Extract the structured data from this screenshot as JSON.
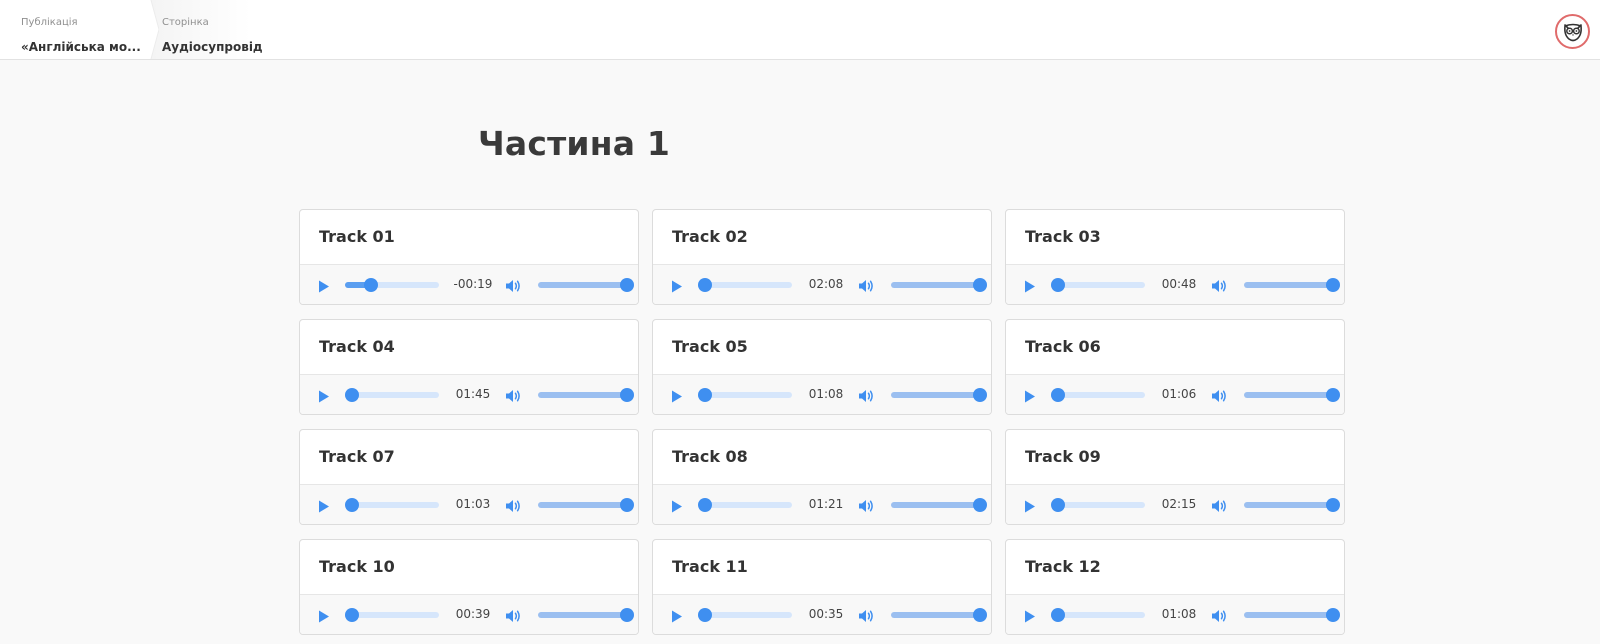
{
  "breadcrumb": {
    "publication_label": "Публікація",
    "publication_value": "«Англійська мо...",
    "page_label": "Сторінка",
    "page_value": "Аудіосупровід"
  },
  "heading": "Частина 1",
  "colors": {
    "accent": "#3f8ff0",
    "track_bg": "#d6e6fb",
    "owl_border": "#e06b6b"
  },
  "icons": {
    "play": "play-icon",
    "volume": "volume-icon",
    "avatar": "owl-icon"
  },
  "tracks": [
    {
      "title": "Track 01",
      "time": "-00:19",
      "progress": 0.24,
      "volume": 1
    },
    {
      "title": "Track 02",
      "time": "02:08",
      "progress": 0,
      "volume": 1
    },
    {
      "title": "Track 03",
      "time": "00:48",
      "progress": 0,
      "volume": 1
    },
    {
      "title": "Track 04",
      "time": "01:45",
      "progress": 0,
      "volume": 1
    },
    {
      "title": "Track 05",
      "time": "01:08",
      "progress": 0,
      "volume": 1
    },
    {
      "title": "Track 06",
      "time": "01:06",
      "progress": 0,
      "volume": 1
    },
    {
      "title": "Track 07",
      "time": "01:03",
      "progress": 0,
      "volume": 1
    },
    {
      "title": "Track 08",
      "time": "01:21",
      "progress": 0,
      "volume": 1
    },
    {
      "title": "Track 09",
      "time": "02:15",
      "progress": 0,
      "volume": 1
    },
    {
      "title": "Track 10",
      "time": "00:39",
      "progress": 0,
      "volume": 1
    },
    {
      "title": "Track 11",
      "time": "00:35",
      "progress": 0,
      "volume": 1
    },
    {
      "title": "Track 12",
      "time": "01:08",
      "progress": 0,
      "volume": 1
    }
  ]
}
